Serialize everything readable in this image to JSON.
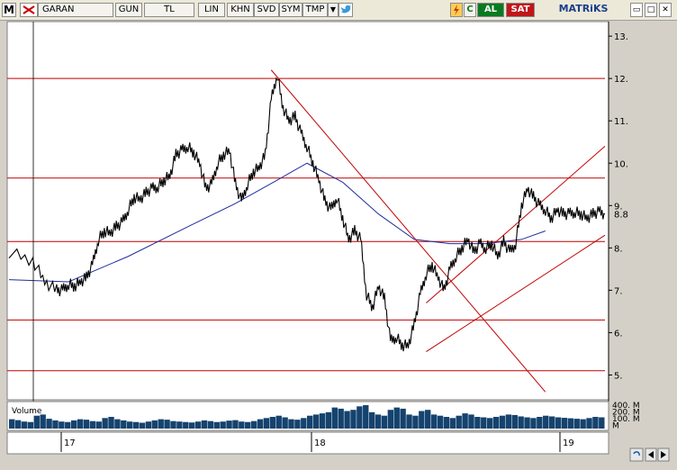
{
  "toolbar": {
    "m_label": "M",
    "symbol": "GARAN",
    "period": "GUN",
    "currency": "TL",
    "lin": "LIN",
    "khn": "KHN",
    "svd": "SVD",
    "sym": "SYM",
    "tmp": "TMP",
    "dropdown": "▼",
    "twitter_icon": "bird-icon",
    "refresh_icon": "c-icon",
    "al": "AL",
    "sat": "SAT",
    "brand": "MATRiKS",
    "win_min": "▭",
    "win_max": "□",
    "win_close": "✕"
  },
  "colors": {
    "price": "#000000",
    "moving_average": "#1f2f9c",
    "levels": "#c00000",
    "volume": "#15436e",
    "background": "#ffffff"
  },
  "chart_data": {
    "type": "line",
    "title": "",
    "symbol": "GARAN",
    "y_axis": {
      "ticks": [
        5,
        6,
        7,
        8,
        9,
        10,
        11,
        12,
        13
      ],
      "min": 4.5,
      "max": 13.3,
      "last_label": "8.8"
    },
    "x_axis": {
      "ticks": [
        "17",
        "18",
        "19"
      ]
    },
    "price_series": {
      "x": [
        0,
        4,
        6,
        8,
        9,
        10,
        11,
        12,
        13,
        14,
        15,
        16,
        17,
        18,
        19,
        20,
        21,
        22,
        23,
        24,
        25,
        26,
        27,
        28,
        29,
        30,
        31,
        32,
        33,
        34,
        35,
        36,
        37,
        38,
        39,
        40,
        41,
        42,
        43,
        44,
        45,
        46,
        47,
        48,
        49,
        50,
        51,
        52,
        53,
        54,
        55,
        56,
        57,
        58,
        59,
        60,
        61,
        62,
        63,
        64,
        65,
        66,
        67,
        68,
        69,
        70,
        71,
        72,
        73,
        74,
        75,
        76,
        77,
        78,
        79,
        80,
        81,
        82,
        83,
        84,
        85,
        86,
        87,
        88,
        89,
        90,
        91,
        92,
        93,
        94,
        95,
        96,
        97,
        98,
        99,
        100
      ],
      "values": [
        7.9,
        7.7,
        7.2,
        7.0,
        7.0,
        7.15,
        7.1,
        7.2,
        7.3,
        7.6,
        8.2,
        8.4,
        8.35,
        8.5,
        8.6,
        8.9,
        9.2,
        9.15,
        9.3,
        9.4,
        9.45,
        9.6,
        9.7,
        10.2,
        10.3,
        10.4,
        10.25,
        10.0,
        9.4,
        9.5,
        10.0,
        10.2,
        10.3,
        9.5,
        9.1,
        9.5,
        9.8,
        9.9,
        10.2,
        11.5,
        12.1,
        11.3,
        11.0,
        11.1,
        10.7,
        10.4,
        10.0,
        9.6,
        9.1,
        8.9,
        9.2,
        8.7,
        8.2,
        8.4,
        8.2,
        6.9,
        6.6,
        7.1,
        6.8,
        5.8,
        5.9,
        5.7,
        5.7,
        6.2,
        6.9,
        7.4,
        7.6,
        7.3,
        7.0,
        7.5,
        7.8,
        8.0,
        8.2,
        7.9,
        8.1,
        8.0,
        8.1,
        7.8,
        8.15,
        7.9,
        8.1,
        9.0,
        9.4,
        9.2,
        9.0,
        8.9,
        8.7,
        8.9,
        8.8,
        8.8,
        8.85,
        8.8,
        8.7,
        8.8,
        8.85,
        8.8
      ],
      "color": "#000000"
    },
    "moving_average": {
      "x": [
        0,
        10,
        20,
        30,
        38,
        45,
        50,
        56,
        62,
        68,
        74,
        80,
        86,
        90
      ],
      "values": [
        7.25,
        7.2,
        7.8,
        8.5,
        9.05,
        9.6,
        10.0,
        9.55,
        8.8,
        8.2,
        8.1,
        8.1,
        8.2,
        8.4
      ],
      "color": "#1f2f9c"
    },
    "horizontal_levels": [
      12.0,
      9.65,
      8.15,
      6.3,
      5.1
    ],
    "trend_lines": [
      {
        "from": [
          44,
          12.2
        ],
        "to": [
          90,
          4.6
        ]
      },
      {
        "from": [
          70,
          5.55
        ],
        "to": [
          100,
          8.3
        ]
      },
      {
        "from": [
          70,
          6.7
        ],
        "to": [
          100,
          10.4
        ]
      }
    ],
    "volume": {
      "label": "Volume",
      "ticks": [
        "400. M",
        "200. M",
        "100. M",
        "M"
      ],
      "values": [
        40,
        36,
        30,
        28,
        55,
        60,
        42,
        35,
        30,
        28,
        35,
        40,
        38,
        32,
        30,
        45,
        50,
        40,
        35,
        30,
        28,
        25,
        30,
        35,
        40,
        38,
        32,
        30,
        28,
        26,
        30,
        35,
        32,
        28,
        30,
        34,
        36,
        30,
        28,
        32,
        40,
        45,
        50,
        55,
        48,
        40,
        38,
        45,
        55,
        60,
        65,
        70,
        90,
        85,
        75,
        80,
        95,
        100,
        70,
        60,
        55,
        80,
        90,
        85,
        60,
        55,
        75,
        80,
        60,
        55,
        50,
        45,
        55,
        65,
        60,
        50,
        48,
        45,
        50,
        55,
        60,
        58,
        52,
        48,
        45,
        50,
        55,
        52,
        48,
        46,
        44,
        42,
        40,
        45,
        50,
        48
      ]
    }
  }
}
